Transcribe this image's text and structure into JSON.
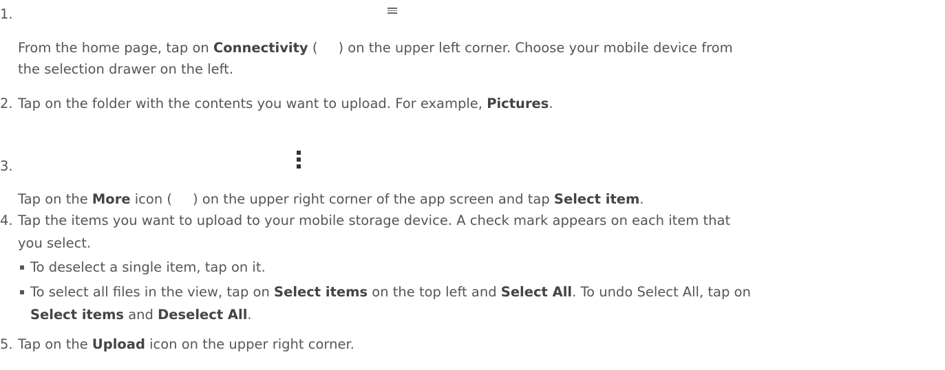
{
  "steps": [
    {
      "number": "1.",
      "lines": [
        {
          "before": "From the home page, tap on ",
          "bold": "Connectivity",
          "after": " (",
          "after2": ") on the upper left corner. Choose your mobile device from"
        },
        {
          "text": "the selection drawer on the left."
        }
      ]
    },
    {
      "number": "2.",
      "lines": [
        {
          "before": "Tap on the folder with the contents you want to upload. For example, ",
          "bold": "Pictures",
          "after": "."
        }
      ]
    },
    {
      "number": "3.",
      "lines": [
        {
          "before": "Tap on the ",
          "bold": "More",
          "after": " icon (",
          "after2": ") on the upper right corner of the app screen and tap ",
          "bold2": "Select item",
          "after3": "."
        }
      ]
    },
    {
      "number": "4.",
      "lines": [
        {
          "text": "Tap the items you want to upload to your mobile storage device. A check mark appears on each item that"
        },
        {
          "text": "you select."
        }
      ],
      "bullets": [
        {
          "text": "To deselect a single item, tap on it."
        },
        {
          "before": "To select all files in the view, tap on ",
          "bold": "Select items",
          "mid": " on the top left and ",
          "bold2": "Select All",
          "after": ". To undo Select All, tap on"
        },
        {
          "bold": "Select items",
          "mid": " and ",
          "bold2": "Deselect All",
          "after": "."
        }
      ]
    },
    {
      "number": "5.",
      "lines": [
        {
          "before": "Tap on the ",
          "bold": "Upload",
          "after": " icon on the upper right corner."
        }
      ]
    }
  ],
  "icons": {
    "step1": "hamburger-menu-icon",
    "step3": "more-vertical-icon"
  }
}
